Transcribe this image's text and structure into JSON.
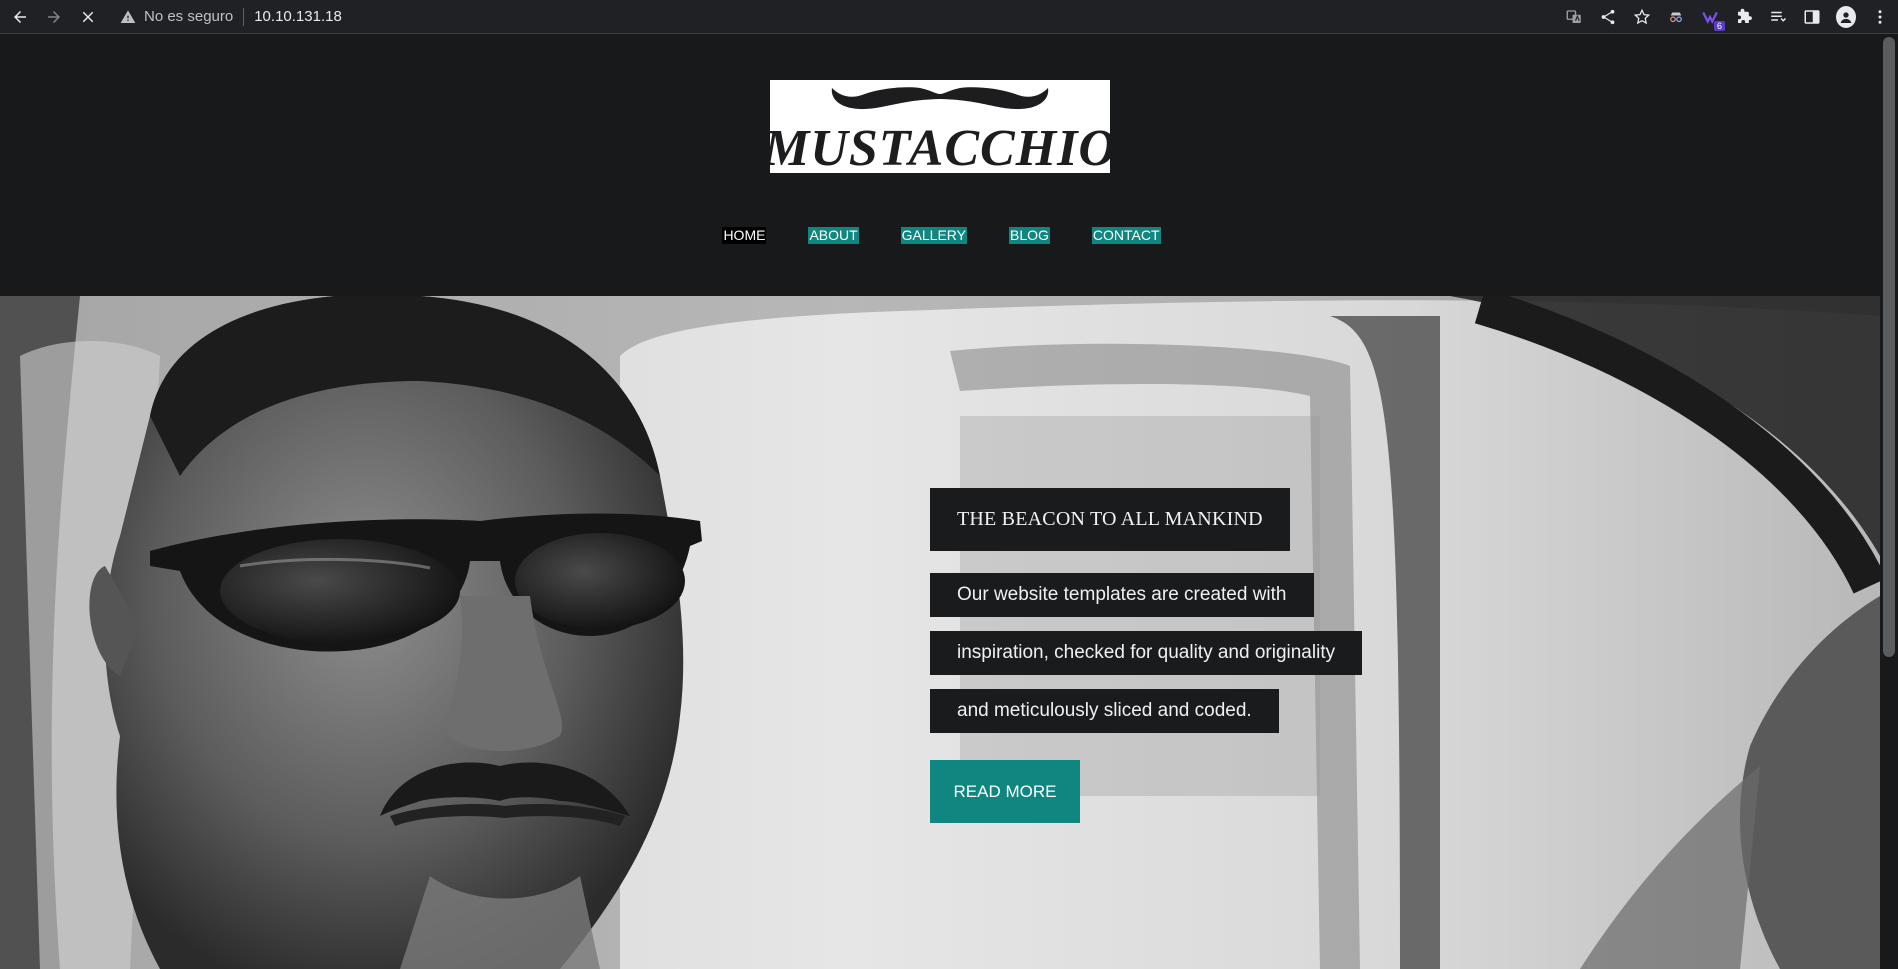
{
  "browser": {
    "security_label": "No es seguro",
    "url": "10.10.131.18",
    "extension_badge": "6"
  },
  "site": {
    "logo_text": "MUSTACCHIO",
    "nav": [
      {
        "label": "HOME"
      },
      {
        "label": "ABOUT"
      },
      {
        "label": "GALLERY"
      },
      {
        "label": "BLOG"
      },
      {
        "label": "CONTACT"
      }
    ]
  },
  "hero": {
    "headline": "THE BEACON TO ALL MANKIND",
    "paragraph_lines": [
      "Our website templates are created with",
      "inspiration, checked for quality and originality",
      "and meticulously sliced and coded."
    ],
    "cta_label": "READ MORE"
  },
  "colors": {
    "accent": "#0f8680",
    "page_bg": "#17191b",
    "text_box_bg": "#1a1b1d"
  }
}
